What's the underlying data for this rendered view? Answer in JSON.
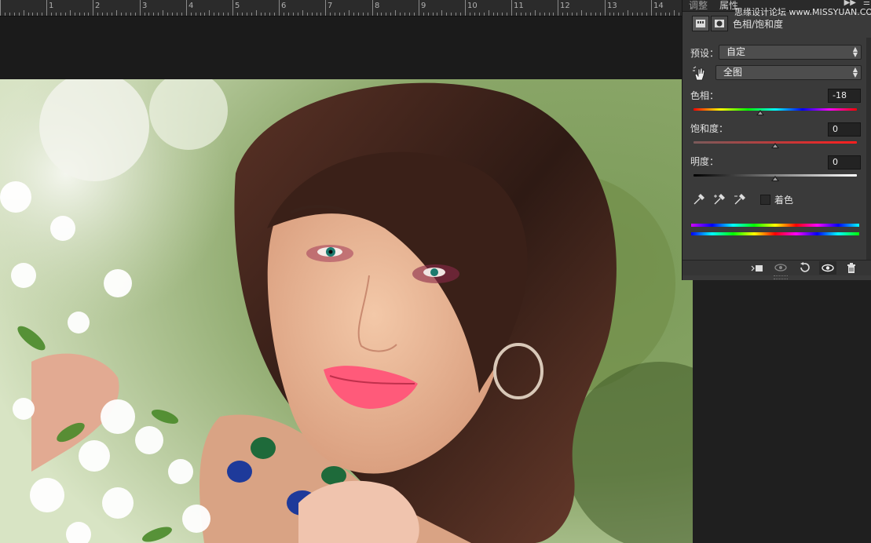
{
  "ruler": {
    "numbers": [
      "1",
      "2",
      "3",
      "4",
      "5",
      "6",
      "7",
      "8",
      "9",
      "10",
      "11",
      "12",
      "13",
      "14"
    ]
  },
  "panel": {
    "tabs": [
      "调整",
      "属性"
    ],
    "watermark": "思缘设计论坛  www.MISSYUAN.COM",
    "title": "色相/饱和度",
    "preset_label": "预设：",
    "preset_value": "自定",
    "range_value": "全图",
    "hue_label": "色相：",
    "hue_value": "-18",
    "saturation_label": "饱和度：",
    "saturation_value": "0",
    "lightness_label": "明度：",
    "lightness_value": "0",
    "colorize_label": "着色"
  },
  "sliders": {
    "hue_fraction": 0.41,
    "saturation_fraction": 0.5,
    "lightness_fraction": 0.5
  },
  "icons": {
    "expand": "double-chevron-icon",
    "menu": "panel-menu-icon",
    "adjustment_layer": "adjustment-layer-icon",
    "mask": "mask-icon",
    "targeted_adjust": "hand-adjust-icon",
    "eyedroppers": [
      "eyedropper-icon",
      "eyedropper-plus-icon",
      "eyedropper-minus-icon"
    ],
    "footer": [
      "clip-to-layer-icon",
      "view-previous-icon",
      "reset-icon",
      "visibility-eye-icon",
      "trash-icon"
    ]
  },
  "colors": {
    "panel_bg": "#3a3a3a",
    "workspace_bg": "#1b1b1b",
    "lipstick": "#ff5a7a"
  }
}
